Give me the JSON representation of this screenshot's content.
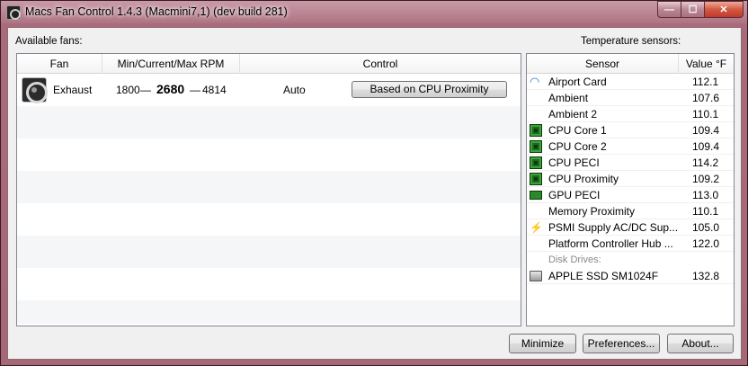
{
  "window": {
    "title": "Macs Fan Control 1.4.3 (Macmini7,1) (dev build 281)",
    "buttons": {
      "minimize": "—",
      "maximize": "☐",
      "close": "✕"
    }
  },
  "fans": {
    "section_label": "Available fans:",
    "columns": {
      "fan": "Fan",
      "rpm": "Min/Current/Max RPM",
      "control": "Control"
    },
    "rows": [
      {
        "icon": "fan-icon",
        "name": "Exhaust",
        "min": "1800",
        "dash1": "—",
        "current": "2680",
        "dash2": "—",
        "max": "4814",
        "mode": "Auto",
        "control_button": "Based on CPU Proximity"
      }
    ]
  },
  "sensors": {
    "section_label": "Temperature sensors:",
    "columns": {
      "sensor": "Sensor",
      "value": "Value °F"
    },
    "rows": [
      {
        "icon": "wifi-icon",
        "name": "Airport Card",
        "value": "112.1"
      },
      {
        "icon": "",
        "name": "Ambient",
        "value": "107.6"
      },
      {
        "icon": "",
        "name": "Ambient 2",
        "value": "110.1"
      },
      {
        "icon": "chip-icon",
        "name": "CPU Core 1",
        "value": "109.4"
      },
      {
        "icon": "chip-icon",
        "name": "CPU Core 2",
        "value": "109.4"
      },
      {
        "icon": "chip-icon",
        "name": "CPU PECI",
        "value": "114.2"
      },
      {
        "icon": "chip-icon",
        "name": "CPU Proximity",
        "value": "109.2"
      },
      {
        "icon": "gpu-icon",
        "name": "GPU PECI",
        "value": "113.0"
      },
      {
        "icon": "",
        "name": "Memory Proximity",
        "value": "110.1"
      },
      {
        "icon": "bolt-icon",
        "name": "PSMI Supply AC/DC Sup...",
        "value": "105.0"
      },
      {
        "icon": "",
        "name": "Platform Controller Hub ...",
        "value": "122.0"
      }
    ],
    "disk_category": "Disk Drives:",
    "disk_rows": [
      {
        "icon": "disk-icon",
        "name": "APPLE SSD SM1024F",
        "value": "132.8"
      }
    ]
  },
  "footer": {
    "minimize": "Minimize",
    "preferences": "Preferences...",
    "about": "About..."
  }
}
